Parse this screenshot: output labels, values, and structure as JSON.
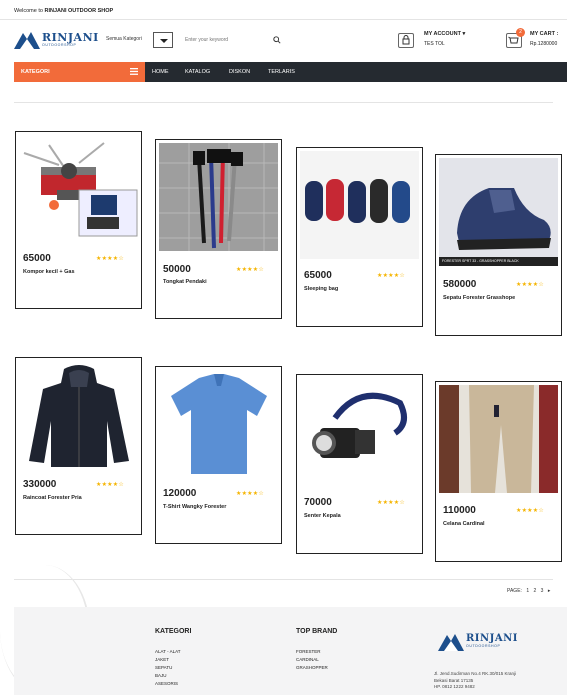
{
  "topbar": {
    "welcome": "Welcome to ",
    "shop_name": "RINJANI OUTDOOR SHOP"
  },
  "logo": {
    "name": "RINJANI",
    "sub": "OUTDOORSHOP"
  },
  "search": {
    "category_label": "Semua Kategori",
    "placeholder": "Enter your keyword"
  },
  "account": {
    "title": "MY ACCOUNT ▾",
    "sub": "TES TOL"
  },
  "cart": {
    "title": "MY CART :",
    "amount": "Rp.1280000",
    "count": "2"
  },
  "nav": {
    "category": "KATEGORI",
    "items": [
      "HOME",
      "KATALOG",
      "DISKON",
      "TERLARIS"
    ]
  },
  "products": [
    {
      "price": "65000",
      "name": "Kompor kecil + Gas",
      "rating": 4
    },
    {
      "price": "50000",
      "name": "Tongkat Pendaki",
      "rating": 4
    },
    {
      "price": "65000",
      "name": "Sleeping bag",
      "rating": 4
    },
    {
      "price": "580000",
      "name": "Sepatu Forester Grasshope",
      "rating": 4,
      "caption": "FORESTER SPRT 33 - GRASSHOPPER BLACK"
    },
    {
      "price": "330000",
      "name": "Raincoat Forester Pria",
      "rating": 4
    },
    {
      "price": "120000",
      "name": "T-Shirt Wangky Forester",
      "rating": 4
    },
    {
      "price": "70000",
      "name": "Senter Kepala",
      "rating": 4
    },
    {
      "price": "110000",
      "name": "Celana Cardinal",
      "rating": 4
    }
  ],
  "pagination": {
    "label": "PAGE:",
    "pages": [
      "1",
      "2",
      "3"
    ],
    "next": "▸"
  },
  "footer": {
    "kategori_title": "KATEGORI",
    "kategori": [
      "ALAT - ALAT",
      "JAKET",
      "SEPATU",
      "BAJU",
      "ASESORIS"
    ],
    "brand_title": "TOP BRAND",
    "brands": [
      "FORESTER",
      "CARDINAL",
      "GRASHOPPER"
    ],
    "address": [
      "Jl. Jend.Sudirman No.4 RK.30/015 Kranji",
      "Bekasi Barat 17135",
      "HP. 0812 1222 9482"
    ]
  },
  "colors": {
    "accent": "#f26b3a",
    "nav_bg": "#252a30",
    "brand": "#1d4f8c",
    "star": "#f5b400"
  }
}
